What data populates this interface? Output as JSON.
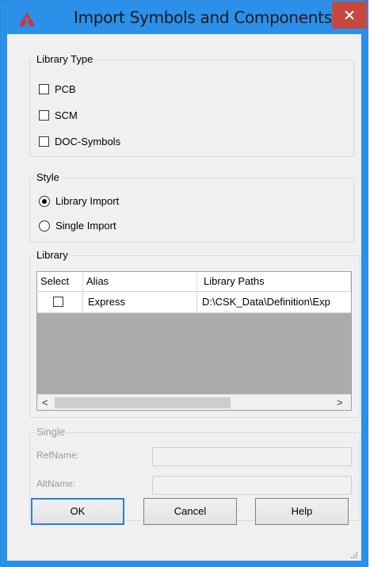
{
  "window": {
    "title": "Import Symbols and Components",
    "close_label": "✕",
    "colors": {
      "titlebar": "#2b90ea",
      "close": "#c7483e",
      "app_icon": "#d9302a"
    }
  },
  "library_type": {
    "legend": "Library Type",
    "options": [
      {
        "label": "PCB",
        "checked": false
      },
      {
        "label": "SCM",
        "checked": false
      },
      {
        "label": "DOC-Symbols",
        "checked": false
      }
    ]
  },
  "style": {
    "legend": "Style",
    "options": [
      {
        "label": "Library Import",
        "selected": true
      },
      {
        "label": "Single Import",
        "selected": false
      }
    ]
  },
  "library": {
    "legend": "Library",
    "columns": [
      "Select",
      "Alias",
      "Library Paths"
    ],
    "rows": [
      {
        "select": false,
        "alias": "Express",
        "path": "D:\\CSK_Data\\Definition\\Exp"
      }
    ],
    "scroll_left": "<",
    "scroll_right": ">"
  },
  "single": {
    "legend": "Single",
    "refname_label": "RefName:",
    "altname_label": "AltName:",
    "refname_value": "",
    "altname_value": ""
  },
  "buttons": {
    "ok": "OK",
    "cancel": "Cancel",
    "help": "Help"
  }
}
